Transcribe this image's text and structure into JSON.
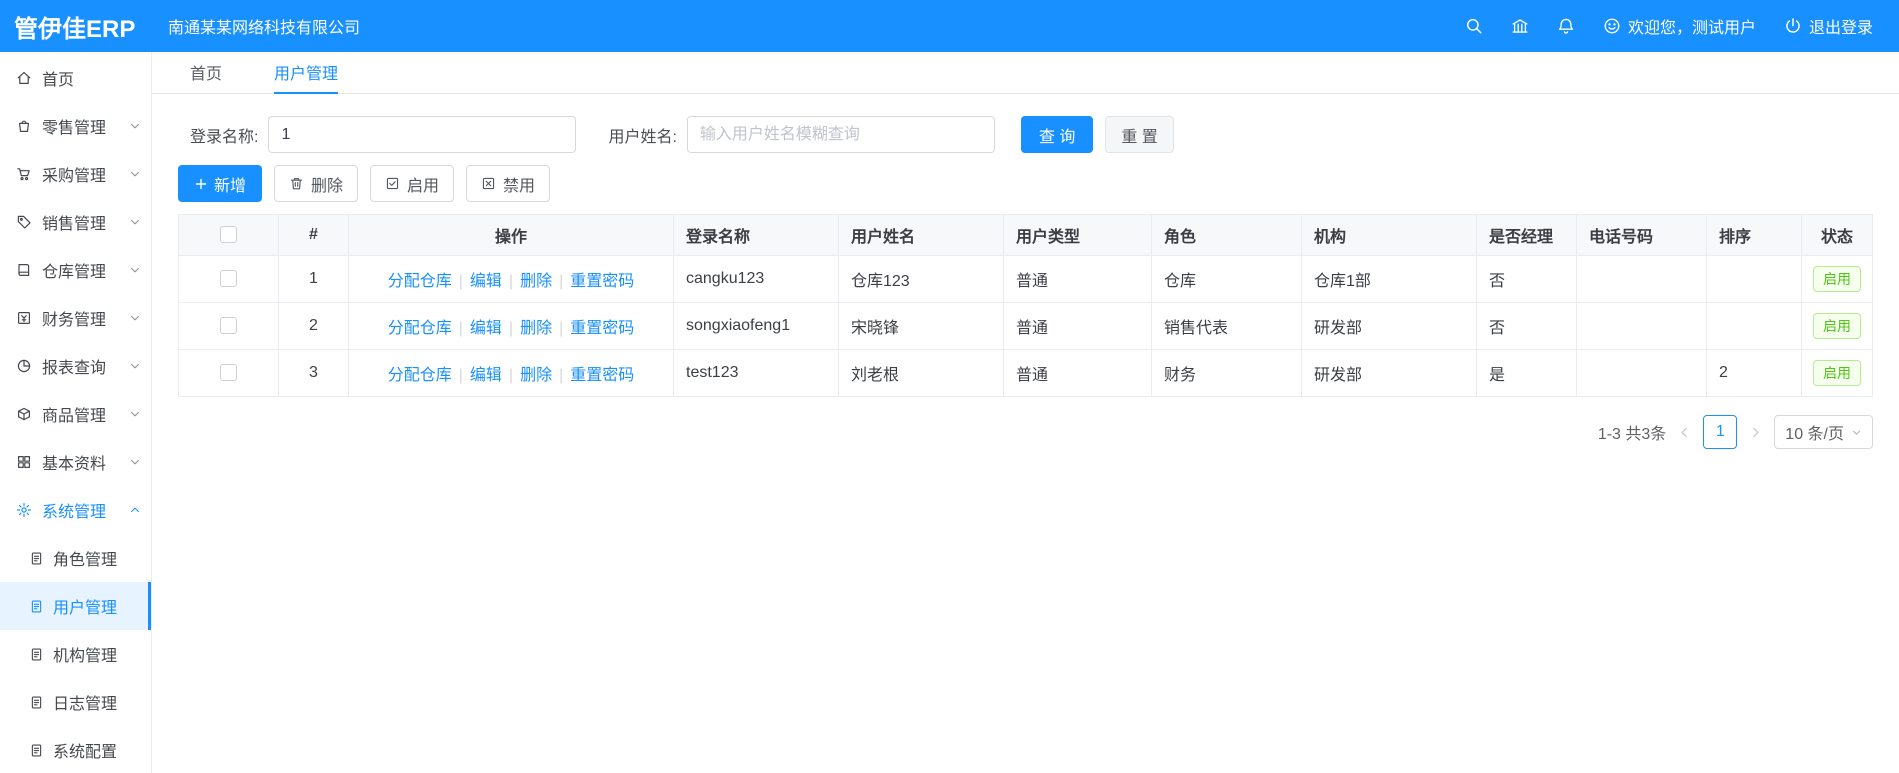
{
  "app": {
    "logo": "管伊佳ERP",
    "company": "南通某某网络科技有限公司"
  },
  "header": {
    "welcome": "欢迎您，测试用户",
    "logout": "退出登录"
  },
  "sidebar": {
    "items": [
      {
        "label": "首页"
      },
      {
        "label": "零售管理"
      },
      {
        "label": "采购管理"
      },
      {
        "label": "销售管理"
      },
      {
        "label": "仓库管理"
      },
      {
        "label": "财务管理"
      },
      {
        "label": "报表查询"
      },
      {
        "label": "商品管理"
      },
      {
        "label": "基本资料"
      },
      {
        "label": "系统管理"
      }
    ],
    "system_children": [
      {
        "label": "角色管理"
      },
      {
        "label": "用户管理"
      },
      {
        "label": "机构管理"
      },
      {
        "label": "日志管理"
      },
      {
        "label": "系统配置"
      }
    ]
  },
  "tabs": [
    {
      "label": "首页"
    },
    {
      "label": "用户管理"
    }
  ],
  "filters": {
    "login_label": "登录名称:",
    "login_value": "1",
    "name_label": "用户姓名:",
    "name_placeholder": "输入用户姓名模糊查询",
    "search": "查 询",
    "reset": "重 置"
  },
  "toolbar": {
    "add": "新增",
    "delete": "删除",
    "enable": "启用",
    "disable": "禁用"
  },
  "table": {
    "link_sep": "|",
    "headers": {
      "index": "#",
      "actions": "操作",
      "login": "登录名称",
      "name": "用户姓名",
      "type": "用户类型",
      "role": "角色",
      "org": "机构",
      "manager": "是否经理",
      "phone": "电话号码",
      "sort": "排序",
      "status": "状态"
    },
    "action_links": {
      "assign": "分配仓库",
      "edit": "编辑",
      "del": "删除",
      "reset_pwd": "重置密码"
    },
    "rows": [
      {
        "index": "1",
        "login": "cangku123",
        "name": "仓库123",
        "type": "普通",
        "role": "仓库",
        "org": "仓库1部",
        "manager": "否",
        "phone": "",
        "sort": "",
        "status": "启用"
      },
      {
        "index": "2",
        "login": "songxiaofeng1",
        "name": "宋晓锋",
        "type": "普通",
        "role": "销售代表",
        "org": "研发部",
        "manager": "否",
        "phone": "",
        "sort": "",
        "status": "启用"
      },
      {
        "index": "3",
        "login": "test123",
        "name": "刘老根",
        "type": "普通",
        "role": "财务",
        "org": "研发部",
        "manager": "是",
        "phone": "",
        "sort": "2",
        "status": "启用"
      }
    ]
  },
  "pagination": {
    "total": "1-3 共3条",
    "page": "1",
    "page_size": "10 条/页"
  },
  "colors": {
    "primary": "#1890ff",
    "success": "#52c41a"
  }
}
